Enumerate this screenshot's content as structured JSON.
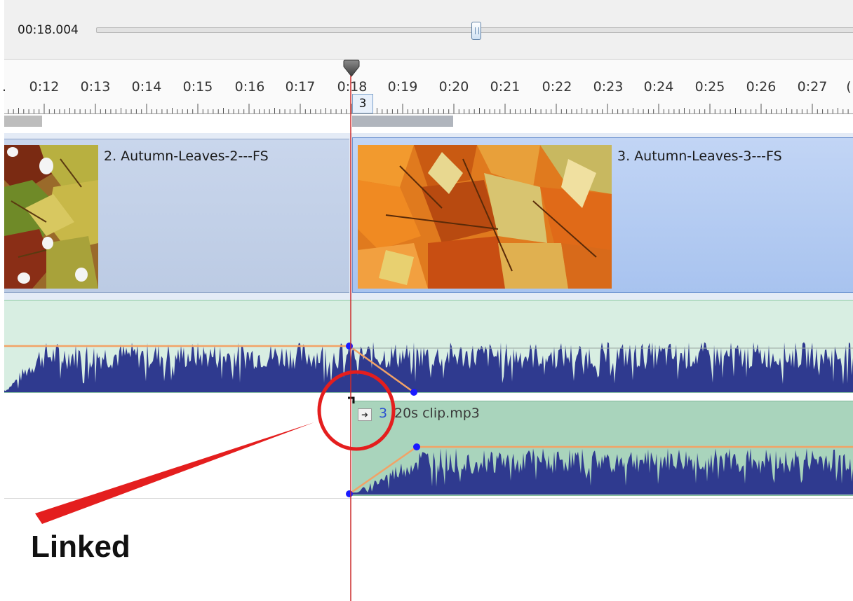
{
  "transport": {
    "time": "00:18.004",
    "position_fraction": 0.5
  },
  "ruler": {
    "labels": [
      "0:12",
      "0:13",
      "0:14",
      "0:15",
      "0:16",
      "0:17",
      "0:18",
      "0:19",
      "0:20",
      "0:21",
      "0:22",
      "0:23",
      "0:24",
      "0:25",
      "0:26",
      "0:27"
    ],
    "marker_label": "3"
  },
  "video_clips": [
    {
      "title": "2. Autumn-Leaves-2---FS"
    },
    {
      "title": "3. Autumn-Leaves-3---FS"
    }
  ],
  "audio_clip": {
    "number": "3",
    "name": "20s clip.mp3",
    "link_icon": "arrow-right-icon"
  },
  "annotation": {
    "label": "Linked",
    "color": "#e41e1e"
  },
  "colors": {
    "playhead": "#cc2b2b",
    "envelope": "#f2a266",
    "waveform": "#2f3a8f",
    "envelope_point": "#1a1aff"
  }
}
